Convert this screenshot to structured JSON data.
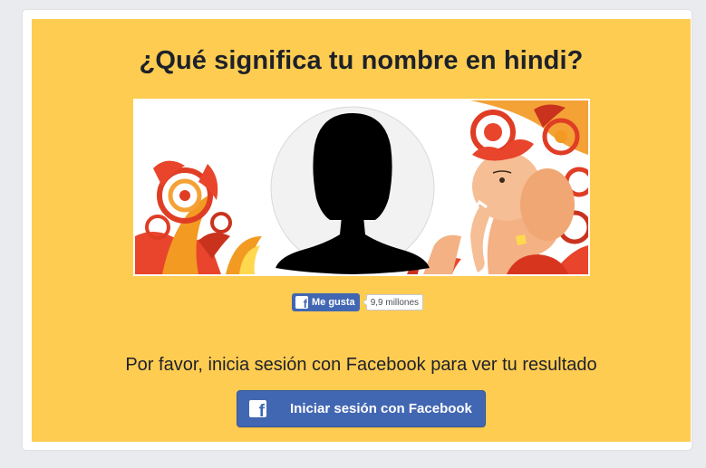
{
  "page": {
    "title": "¿Qué significa tu nombre en hindi?",
    "prompt": "Por favor, inicia sesión con Facebook para ver tu resultado"
  },
  "like_widget": {
    "label": "Me gusta",
    "count": "9,9 millones",
    "icon": "facebook-f-icon"
  },
  "login": {
    "label": "Iniciar sesión con Facebook",
    "icon": "facebook-f-icon"
  },
  "banner": {
    "avatar_icon": "profile-silhouette-icon",
    "decoration": "ganesha-illustration"
  },
  "colors": {
    "panel_background": "#ffcc52",
    "facebook_blue": "#4267b2",
    "text_dark": "#1d2129",
    "page_background": "#e9ebee"
  }
}
